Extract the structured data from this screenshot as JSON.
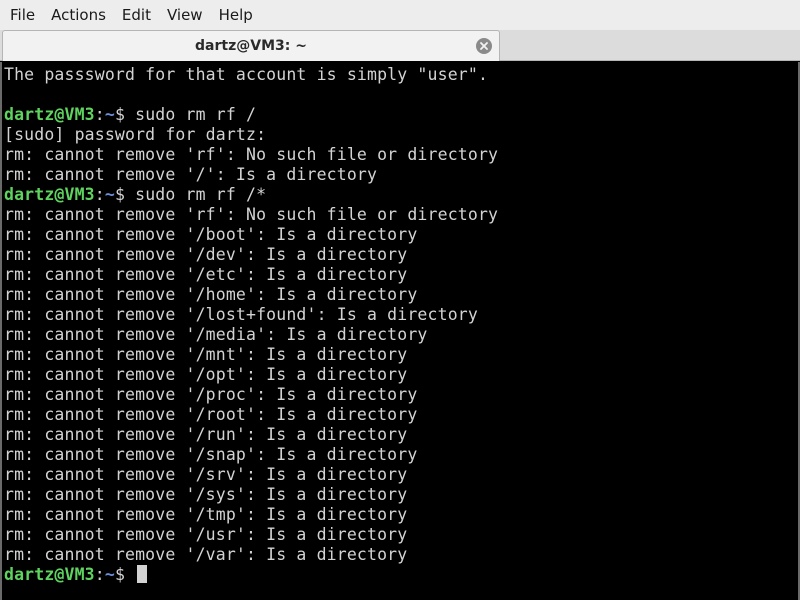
{
  "menubar": {
    "items": [
      "File",
      "Actions",
      "Edit",
      "View",
      "Help"
    ]
  },
  "tab": {
    "title": "dartz@VM3: ~",
    "close_icon": "close-icon"
  },
  "prompt": {
    "user_host": "dartz@VM3",
    "colon": ":",
    "path": "~",
    "dollar": "$ "
  },
  "terminal": {
    "lines": [
      {
        "type": "text",
        "text": "The passsword for that account is simply \"user\"."
      },
      {
        "type": "text",
        "text": ""
      },
      {
        "type": "prompt",
        "command": "sudo rm rf /"
      },
      {
        "type": "text",
        "text": "[sudo] password for dartz:"
      },
      {
        "type": "text",
        "text": "rm: cannot remove 'rf': No such file or directory"
      },
      {
        "type": "text",
        "text": "rm: cannot remove '/': Is a directory"
      },
      {
        "type": "prompt",
        "command": "sudo rm rf /*"
      },
      {
        "type": "text",
        "text": "rm: cannot remove 'rf': No such file or directory"
      },
      {
        "type": "text",
        "text": "rm: cannot remove '/boot': Is a directory"
      },
      {
        "type": "text",
        "text": "rm: cannot remove '/dev': Is a directory"
      },
      {
        "type": "text",
        "text": "rm: cannot remove '/etc': Is a directory"
      },
      {
        "type": "text",
        "text": "rm: cannot remove '/home': Is a directory"
      },
      {
        "type": "text",
        "text": "rm: cannot remove '/lost+found': Is a directory"
      },
      {
        "type": "text",
        "text": "rm: cannot remove '/media': Is a directory"
      },
      {
        "type": "text",
        "text": "rm: cannot remove '/mnt': Is a directory"
      },
      {
        "type": "text",
        "text": "rm: cannot remove '/opt': Is a directory"
      },
      {
        "type": "text",
        "text": "rm: cannot remove '/proc': Is a directory"
      },
      {
        "type": "text",
        "text": "rm: cannot remove '/root': Is a directory"
      },
      {
        "type": "text",
        "text": "rm: cannot remove '/run': Is a directory"
      },
      {
        "type": "text",
        "text": "rm: cannot remove '/snap': Is a directory"
      },
      {
        "type": "text",
        "text": "rm: cannot remove '/srv': Is a directory"
      },
      {
        "type": "text",
        "text": "rm: cannot remove '/sys': Is a directory"
      },
      {
        "type": "text",
        "text": "rm: cannot remove '/tmp': Is a directory"
      },
      {
        "type": "text",
        "text": "rm: cannot remove '/usr': Is a directory"
      },
      {
        "type": "text",
        "text": "rm: cannot remove '/var': Is a directory"
      },
      {
        "type": "prompt",
        "command": "",
        "cursor": true
      }
    ]
  },
  "colors": {
    "prompt_user": "#5fd35f",
    "prompt_path": "#6b8fd8",
    "foreground": "#d3d3d3",
    "background": "#000000"
  }
}
